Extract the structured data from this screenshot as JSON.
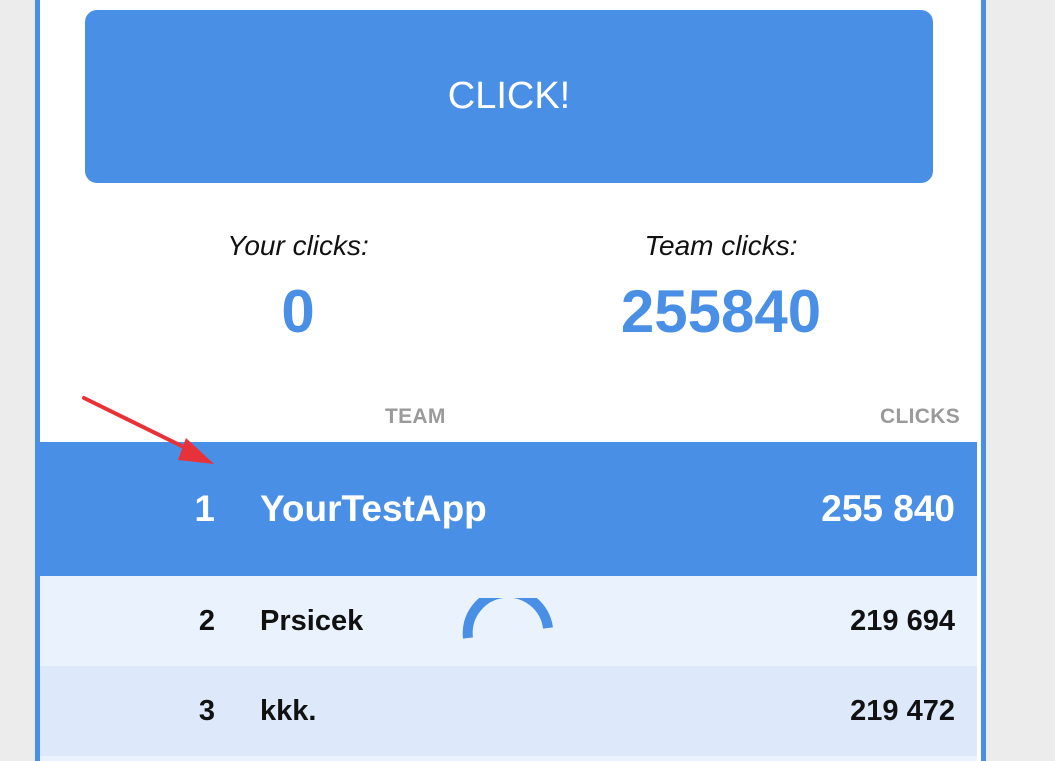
{
  "click_button": {
    "label": "CLICK!"
  },
  "stats": {
    "your_clicks_label": "Your clicks:",
    "your_clicks_value": "0",
    "team_clicks_label": "Team clicks:",
    "team_clicks_value": "255840"
  },
  "leaderboard": {
    "headers": {
      "team": "TEAM",
      "clicks": "CLICKS"
    },
    "rows": [
      {
        "rank": "1",
        "team": "YourTestApp",
        "clicks": "255 840"
      },
      {
        "rank": "2",
        "team": "Prsicek",
        "clicks": "219 694"
      },
      {
        "rank": "3",
        "team": "kkk.",
        "clicks": "219 472"
      }
    ]
  },
  "colors": {
    "accent": "#4a8fe6",
    "row_light": "#eaf2fd",
    "row_mid": "#dde9fa",
    "header_gray": "#9a9a9a",
    "annotation_arrow": "#e8323a"
  },
  "icons": {
    "loading": "loading-spinner-icon",
    "annotation": "red-arrow-annotation"
  }
}
